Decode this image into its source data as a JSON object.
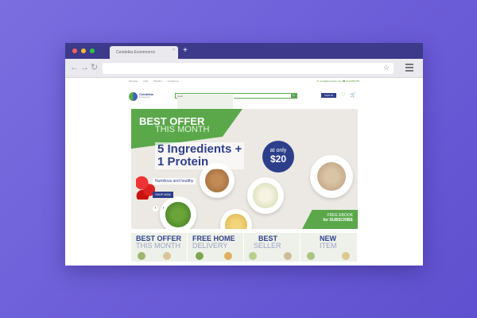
{
  "browser": {
    "tab_title": "Cendekia Ecommerce",
    "tab_close": "×",
    "new_tab": "+",
    "back": "←",
    "forward": "→",
    "reload": "↻",
    "bookmark": "☆"
  },
  "site": {
    "top_links": [
      "Services",
      "FAQ",
      "Wishlist",
      "Contact us"
    ],
    "top_right": "✉ email@example.com  ☎ 0123456789",
    "logo_name": "Cendekia",
    "logo_sub": "Ecommerce",
    "search_category": "Food",
    "search_icon": "🔍",
    "header_button": "SIGN IN",
    "heart_icon": "♡",
    "cart_icon": "🛒"
  },
  "hero": {
    "offer_line1": "BEST OFFER",
    "offer_line2": "THIS MONTH",
    "headline_line1": "5 Ingredients +",
    "headline_line2": "1 Protein",
    "badge_line1": "at only",
    "badge_price": "$20",
    "subtitle": "Nutritious and healthy",
    "shop_button": "SHOP NOW",
    "prev_icon": "‹",
    "next_icon": "›",
    "ebook_line1": "FREE EBOOK",
    "ebook_line2": "for SUBSCRIBE"
  },
  "categories": [
    {
      "line1": "BEST OFFER",
      "line2": "THIS MONTH"
    },
    {
      "line1": "FREE HOME",
      "line2": "DELIVERY"
    },
    {
      "line1": "BEST",
      "line2": "SELLER"
    },
    {
      "line1": "NEW",
      "line2": "ITEM"
    }
  ],
  "colors": {
    "brand_blue": "#2d3f8a",
    "brand_green": "#5aa84a",
    "background": "#6a5bd6"
  }
}
